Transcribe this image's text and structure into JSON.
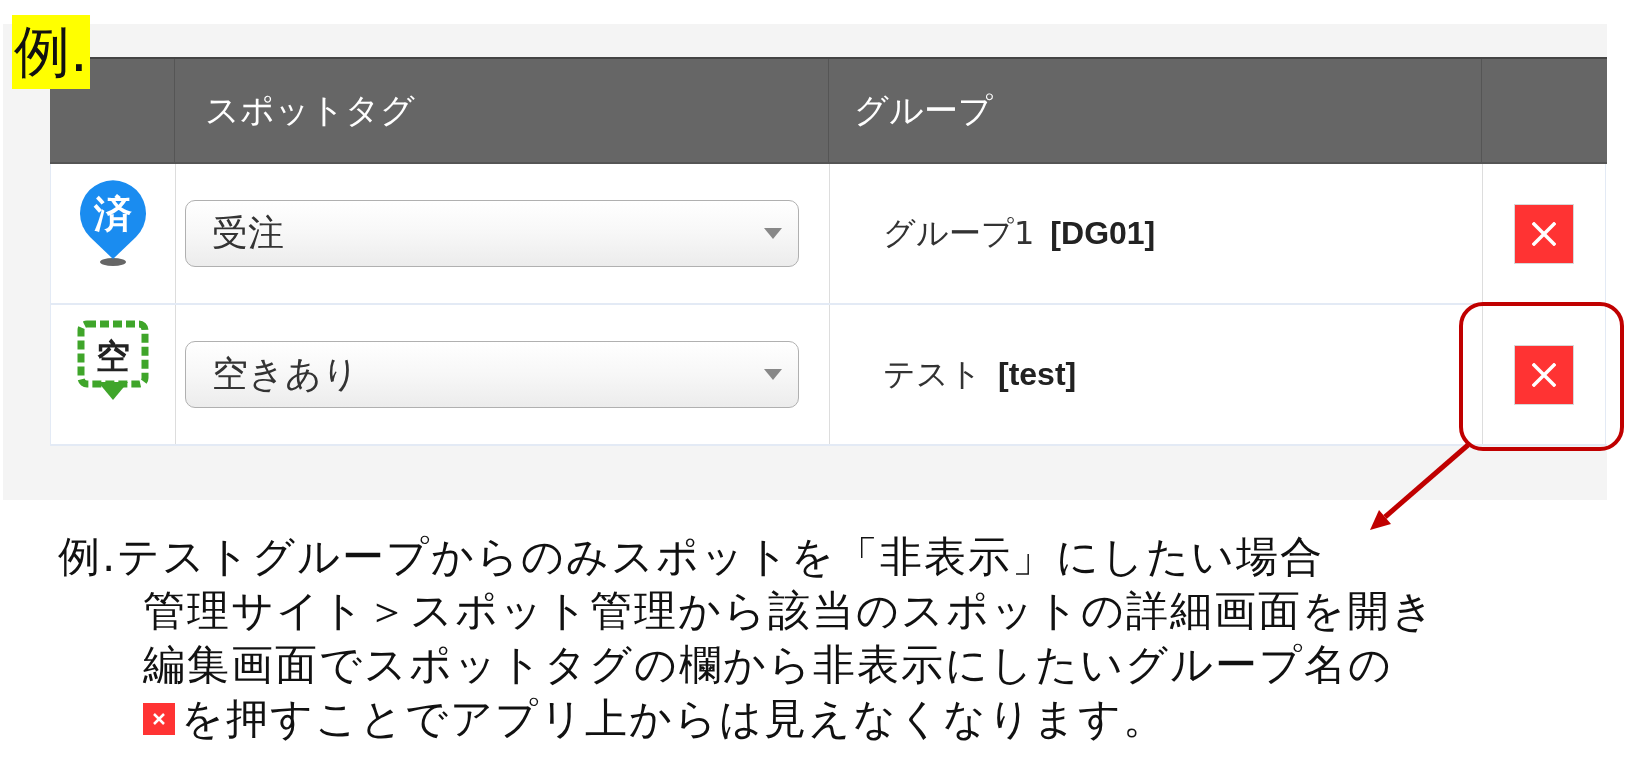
{
  "example_label": "例.",
  "table": {
    "columns": [
      "スポットタグ",
      "グループ"
    ],
    "rows": [
      {
        "marker": {
          "kind": "pin",
          "label": "済",
          "color": "#1a8cf0"
        },
        "tag": "受注",
        "group_name": "グループ1",
        "group_code": "[DG01]",
        "highlighted": false
      },
      {
        "marker": {
          "kind": "dashed-square",
          "label": "空",
          "color": "#3fa52a"
        },
        "tag": "空きあり",
        "group_name": "テスト",
        "group_code": "[test]",
        "highlighted": true
      }
    ]
  },
  "note": {
    "heading": "例.テストグループからのみスポットを「非表示」にしたい場合",
    "lines": [
      "管理サイト＞スポット管理から該当のスポットの詳細画面を開き",
      "編集画面でスポットタグの欄から非表示にしたいグループ名の"
    ],
    "final_line": "を押すことでアプリ上からは見えなくなります。"
  }
}
